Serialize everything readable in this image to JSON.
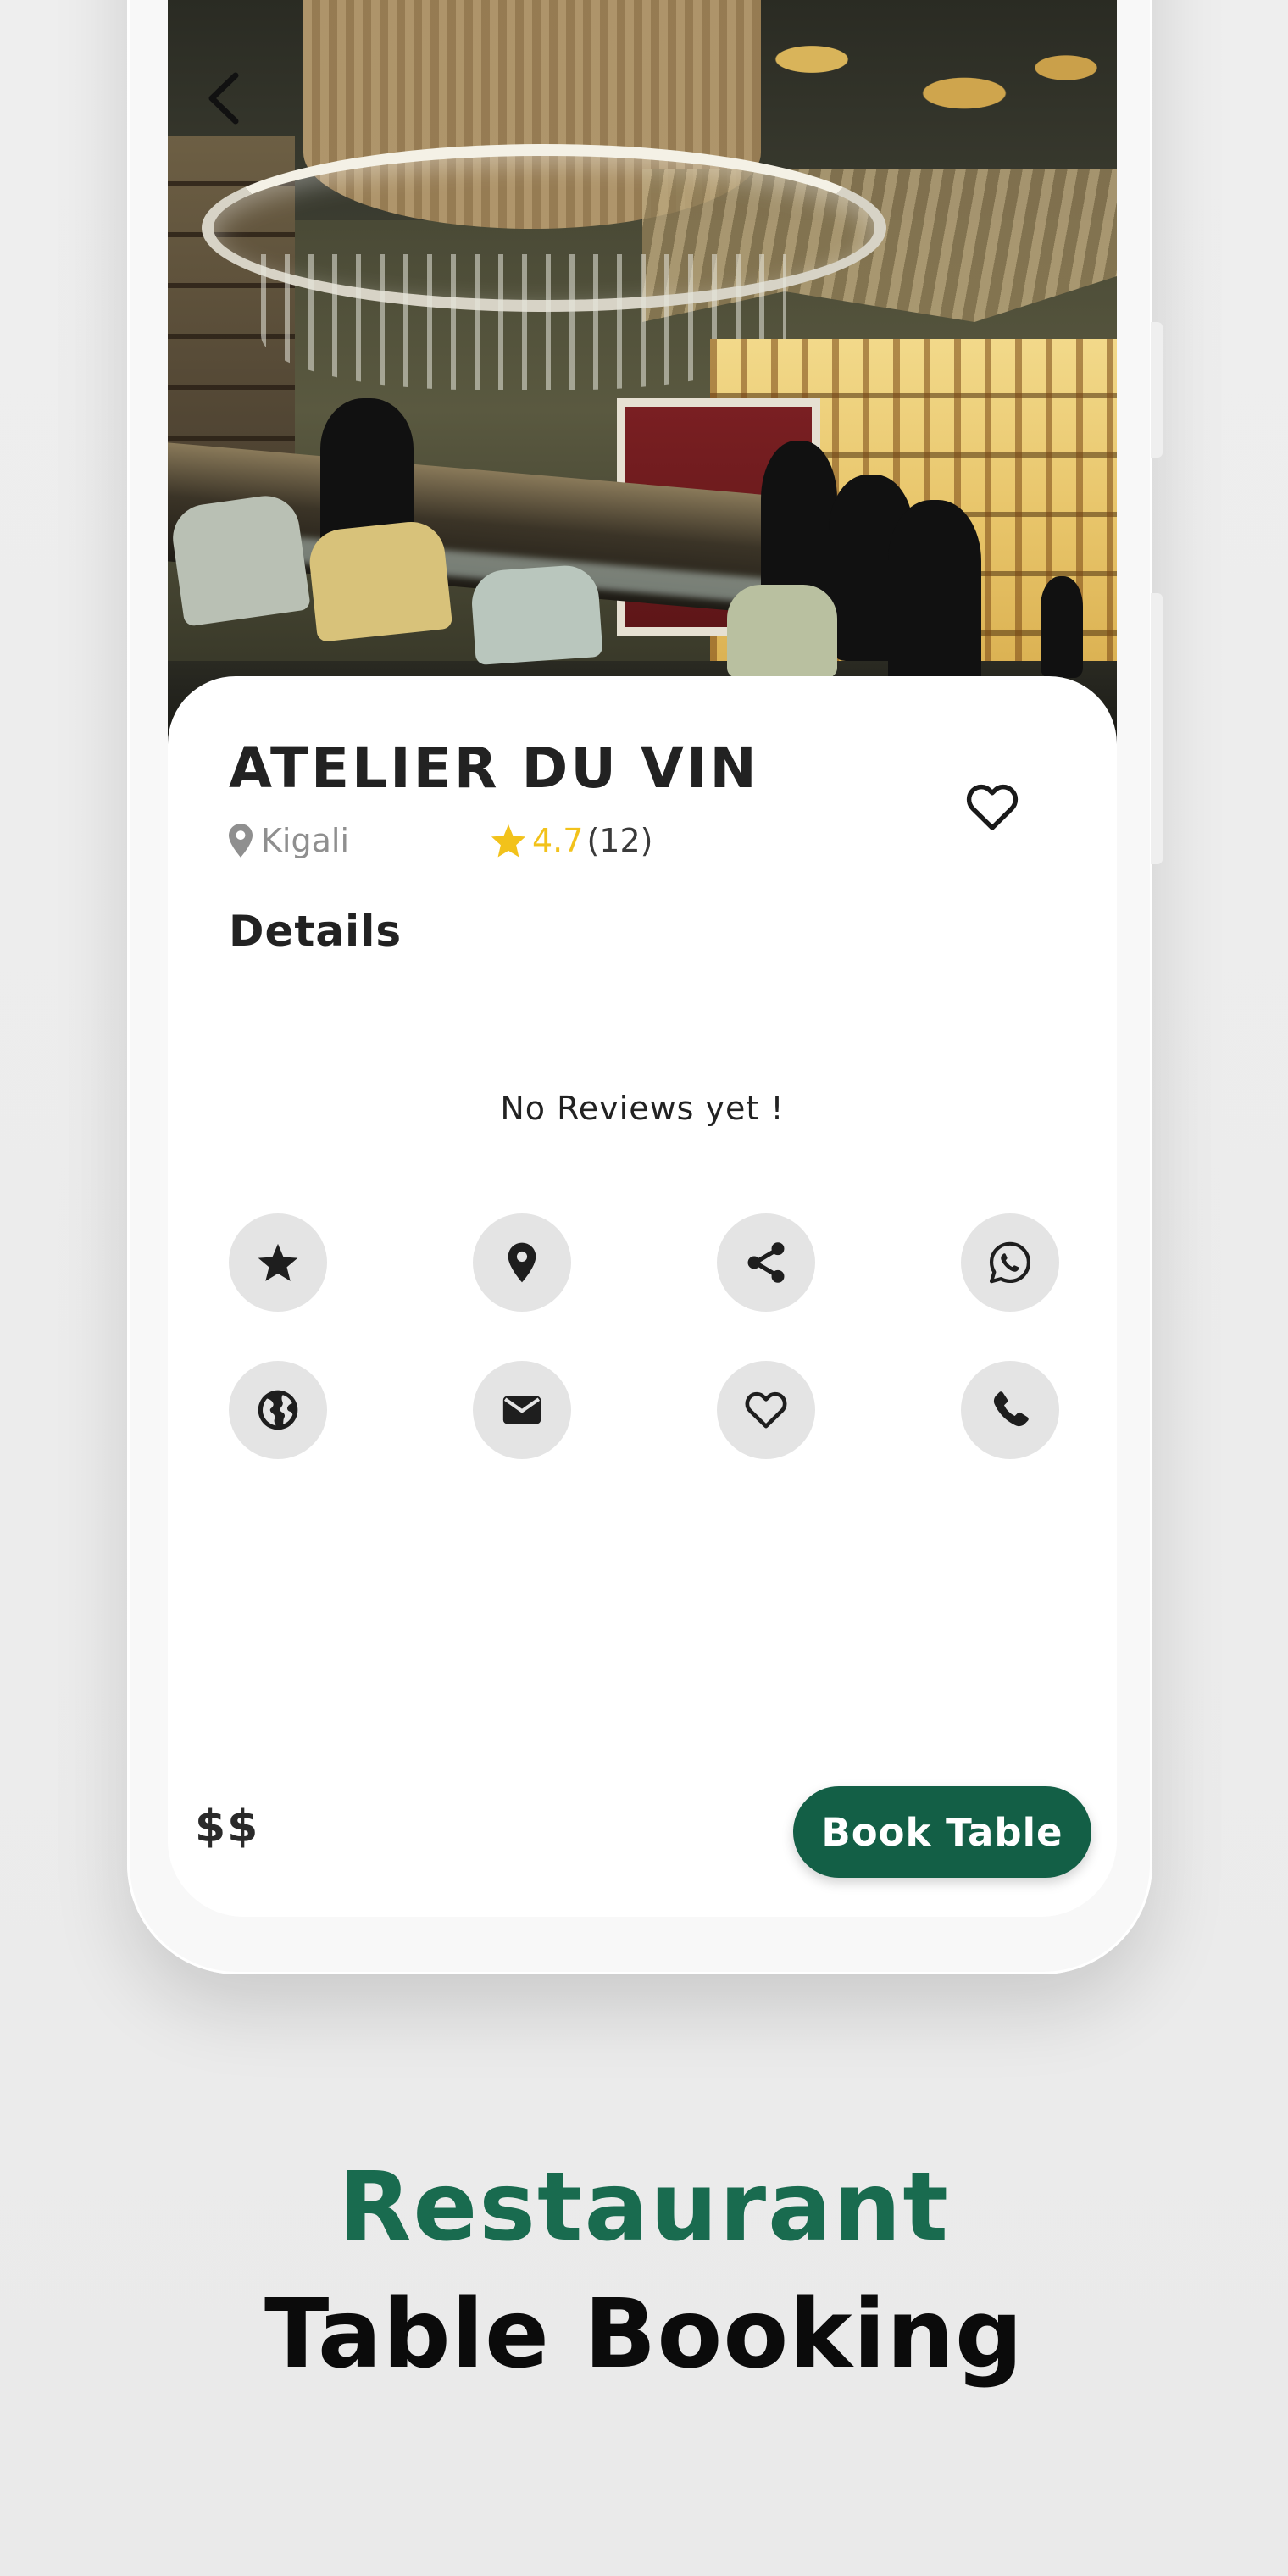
{
  "restaurant": {
    "name": "ATELIER DU VIN",
    "location": "Kigali",
    "rating": "4.7",
    "review_count": "(12)",
    "price_level": "$$"
  },
  "details": {
    "section_title": "Details",
    "empty_reviews_text": "No Reviews yet !"
  },
  "actions": [
    {
      "icon": "star-icon",
      "label": "rate"
    },
    {
      "icon": "location-pin-icon",
      "label": "location"
    },
    {
      "icon": "share-icon",
      "label": "share"
    },
    {
      "icon": "whatsapp-icon",
      "label": "whatsapp"
    },
    {
      "icon": "globe-icon",
      "label": "website"
    },
    {
      "icon": "mail-icon",
      "label": "email"
    },
    {
      "icon": "heart-outline-icon",
      "label": "favorite"
    },
    {
      "icon": "phone-icon",
      "label": "call"
    }
  ],
  "footer": {
    "book_button_label": "Book Table"
  },
  "caption": {
    "line1": "Restaurant",
    "line2": "Table Booking"
  },
  "colors": {
    "brand_green": "#135f46",
    "caption_green": "#196b4f",
    "rating_star": "#f2c21b",
    "icon_circle_bg": "#e4e4e4",
    "background": "#eeeeee"
  }
}
